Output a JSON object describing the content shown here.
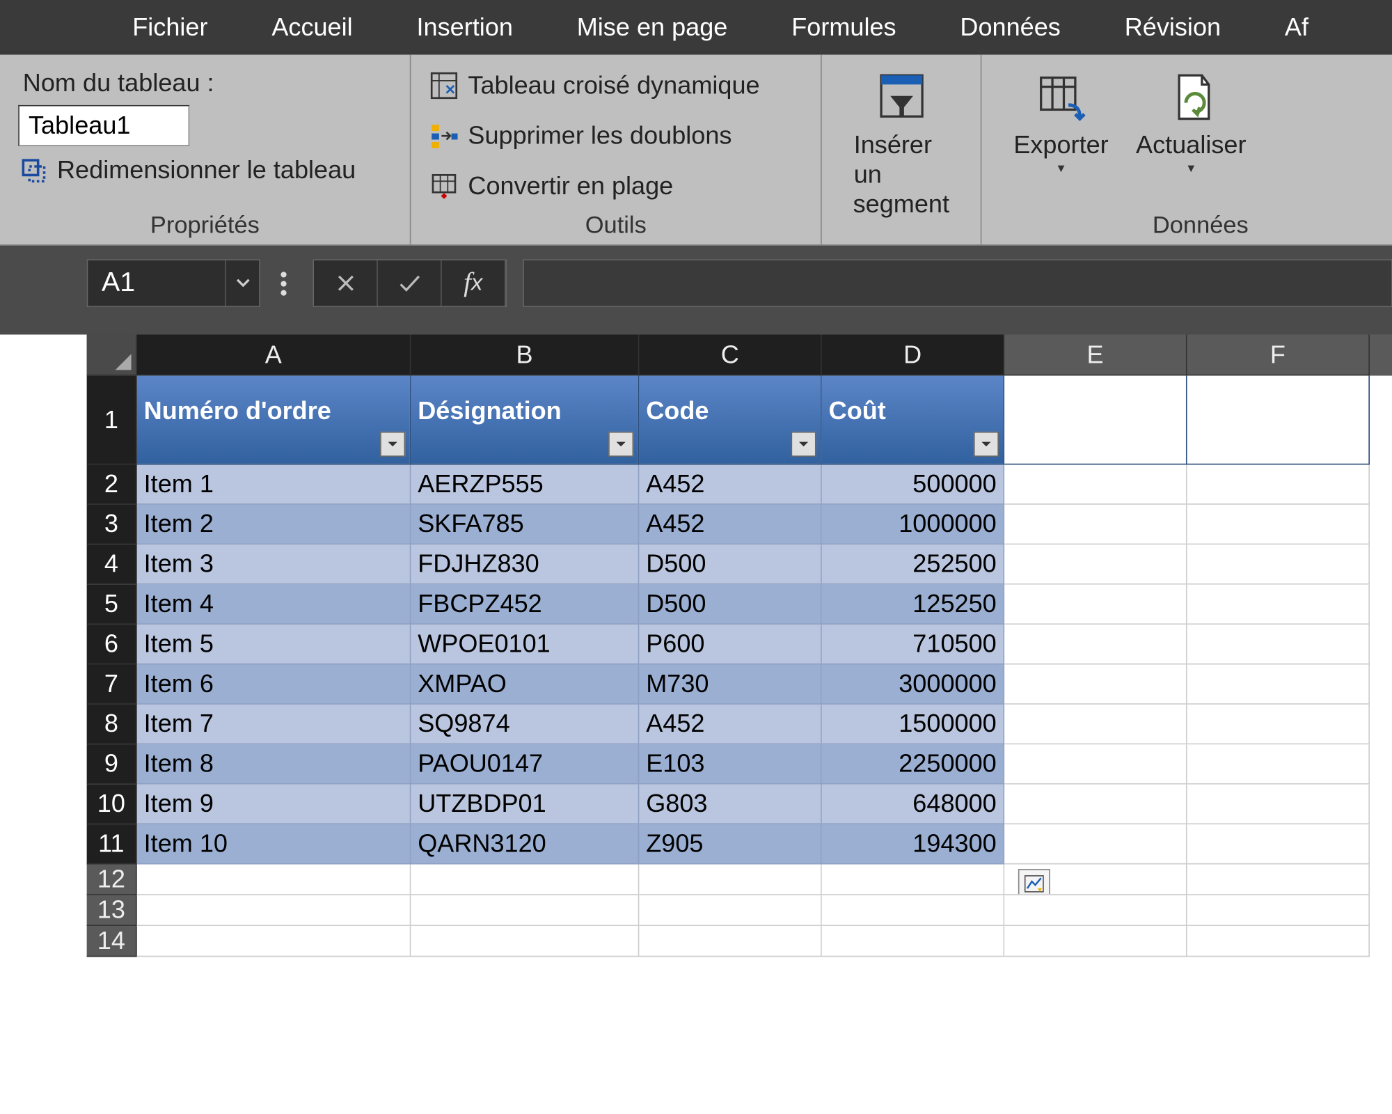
{
  "menubar": [
    "Fichier",
    "Accueil",
    "Insertion",
    "Mise en page",
    "Formules",
    "Données",
    "Révision",
    "Af"
  ],
  "ribbon": {
    "properties": {
      "name_label": "Nom du tableau :",
      "table_name": "Tableau1",
      "resize": "Redimensionner le tableau",
      "group_label": "Propriétés"
    },
    "tools": {
      "pivot": "Tableau croisé dynamique",
      "dedup": "Supprimer les doublons",
      "convert": "Convertir en plage",
      "group_label": "Outils"
    },
    "slicer": {
      "line1": "Insérer un",
      "line2": "segment"
    },
    "export": "Exporter",
    "refresh": "Actualiser",
    "data_group": "Données"
  },
  "formula_bar": {
    "name_box": "A1",
    "formula": ""
  },
  "columns": [
    "A",
    "B",
    "C",
    "D",
    "E",
    "F"
  ],
  "selected_cols_count": 4,
  "table": {
    "headers": [
      "Numéro d'ordre",
      "Désignation",
      "Code",
      "Coût"
    ],
    "rows": [
      [
        "Item 1",
        "AERZP555",
        "A452",
        "500000"
      ],
      [
        "Item 2",
        "SKFA785",
        "A452",
        "1000000"
      ],
      [
        "Item 3",
        "FDJHZ830",
        "D500",
        "252500"
      ],
      [
        "Item 4",
        "FBCPZ452",
        "D500",
        "125250"
      ],
      [
        "Item 5",
        "WPOE0101",
        "P600",
        "710500"
      ],
      [
        "Item 6",
        "XMPAO",
        "M730",
        "3000000"
      ],
      [
        "Item 7",
        "SQ9874",
        "A452",
        "1500000"
      ],
      [
        "Item 8",
        "PAOU0147",
        "E103",
        "2250000"
      ],
      [
        "Item 9",
        "UTZBDP01",
        "G803",
        "648000"
      ],
      [
        "Item 10",
        "QARN3120",
        "Z905",
        "194300"
      ]
    ],
    "header_row_num": 1
  },
  "extra_empty_rows": [
    12,
    13,
    14
  ]
}
